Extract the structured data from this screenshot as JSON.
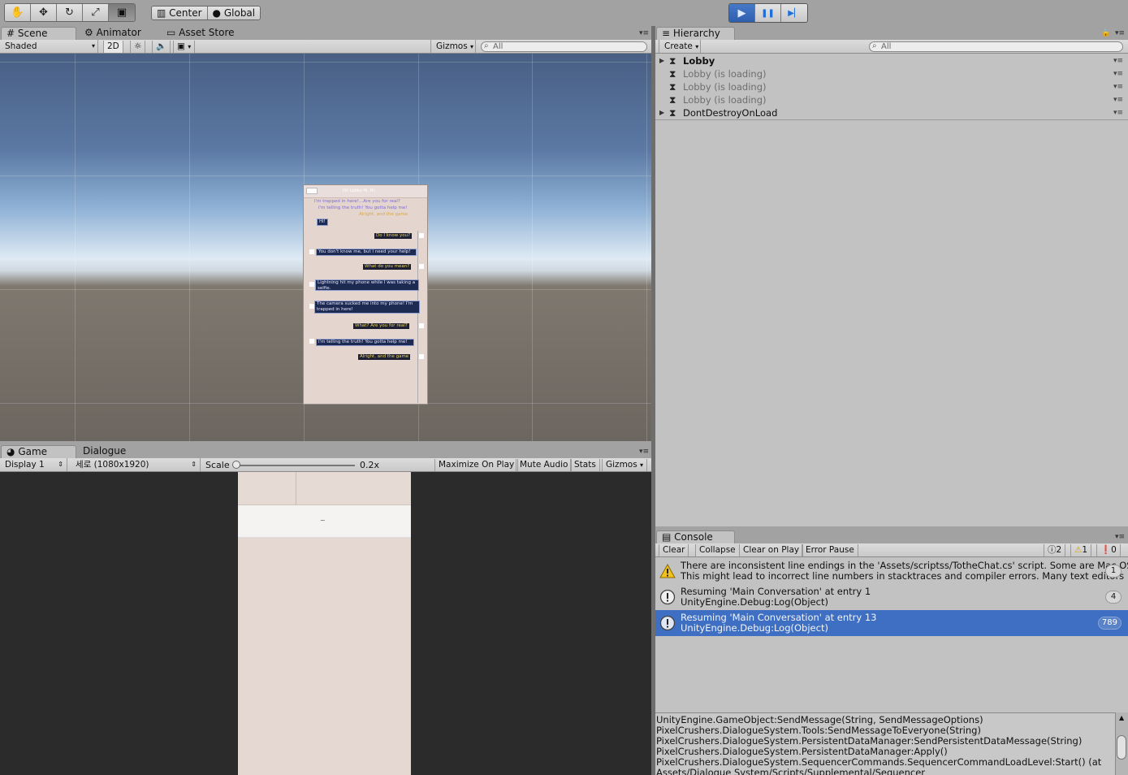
{
  "toolbar": {
    "tools": [
      "hand-tool",
      "move-tool",
      "rotate-tool",
      "scale-tool",
      "rect-tool"
    ],
    "pivot_label": "Center",
    "space_label": "Global",
    "play": "▶",
    "pause": "❚❚",
    "step": "▶▏"
  },
  "scene_panel": {
    "tabs": [
      "Scene",
      "Animator",
      "Asset Store"
    ],
    "shading_mode": "Shaded",
    "mode_2d": "2D",
    "gizmos": "Gizmos",
    "search_placeholder": "All"
  },
  "scene_canvas": {
    "header_title": "Hi! Lobby Hi. Hi.",
    "top_lines": [
      "I'm trapped in here!...Are you for real?",
      "I'm telling the truth! You gotta help me!",
      "Alright, and the game"
    ],
    "hi_tag": "Hi!",
    "messages": [
      {
        "side": "right",
        "text": "Do I know you?"
      },
      {
        "side": "left",
        "text": "You don't know me, but I need your help!"
      },
      {
        "side": "right",
        "text": "What do you mean?"
      },
      {
        "side": "left",
        "text": "Lightning hit my phone while I was taking a selfie."
      },
      {
        "side": "left",
        "text": "The camera sucked me into my phone! I'm trapped in here!"
      },
      {
        "side": "right",
        "text": "What? Are you for real?"
      },
      {
        "side": "left",
        "text": "I'm telling the truth! You gotta help me!"
      },
      {
        "side": "right",
        "text": "Alright, and the game"
      }
    ]
  },
  "game_panel": {
    "tabs": [
      "Game",
      "Dialogue"
    ],
    "display": "Display 1",
    "resolution": "세로 (1080x1920)",
    "scale_label": "Scale",
    "scale_value": "0.2x",
    "scale_slider_fraction": 0.0,
    "maximize": "Maximize On Play",
    "mute": "Mute Audio",
    "stats": "Stats",
    "gizmos": "Gizmos",
    "phone_center_text": "~"
  },
  "hierarchy": {
    "tab": "Hierarchy",
    "create": "Create",
    "search_placeholder": "All",
    "rows": [
      {
        "label": "Lobby",
        "bold": true,
        "expandable": true,
        "dim": false
      },
      {
        "label": "Lobby (is loading)",
        "bold": false,
        "expandable": false,
        "dim": true
      },
      {
        "label": "Lobby (is loading)",
        "bold": false,
        "expandable": false,
        "dim": true
      },
      {
        "label": "Lobby (is loading)",
        "bold": false,
        "expandable": false,
        "dim": true
      },
      {
        "label": "DontDestroyOnLoad",
        "bold": false,
        "expandable": true,
        "dim": false
      }
    ]
  },
  "console": {
    "tab": "Console",
    "buttons": [
      "Clear",
      "Collapse",
      "Clear on Play",
      "Error Pause"
    ],
    "info_count": "2",
    "warn_count": "1",
    "error_count": "0",
    "entries": [
      {
        "type": "warning",
        "line1": "There are inconsistent line endings in the 'Assets/scriptss/TotheChat.cs' script. Some are Mac OS",
        "line2": "This might lead to incorrect line numbers in stacktraces and compiler errors. Many text editors",
        "count": "1",
        "selected": false
      },
      {
        "type": "info",
        "line1": "Resuming 'Main Conversation' at entry 1",
        "line2": "UnityEngine.Debug:Log(Object)",
        "count": "4",
        "selected": false
      },
      {
        "type": "info",
        "line1": "Resuming 'Main Conversation' at entry 13",
        "line2": "UnityEngine.Debug:Log(Object)",
        "count": "789",
        "selected": true
      }
    ],
    "stacktrace": [
      "UnityEngine.GameObject:SendMessage(String, SendMessageOptions)",
      "PixelCrushers.DialogueSystem.Tools:SendMessageToEveryone(String)",
      "PixelCrushers.DialogueSystem.PersistentDataManager:SendPersistentDataMessage(String)",
      "PixelCrushers.DialogueSystem.PersistentDataManager:Apply()",
      "PixelCrushers.DialogueSystem.SequencerCommands.SequencerCommandLoadLevel:Start() (at",
      "Assets/Dialogue System/Scripts/Supplemental/Sequencer"
    ]
  }
}
